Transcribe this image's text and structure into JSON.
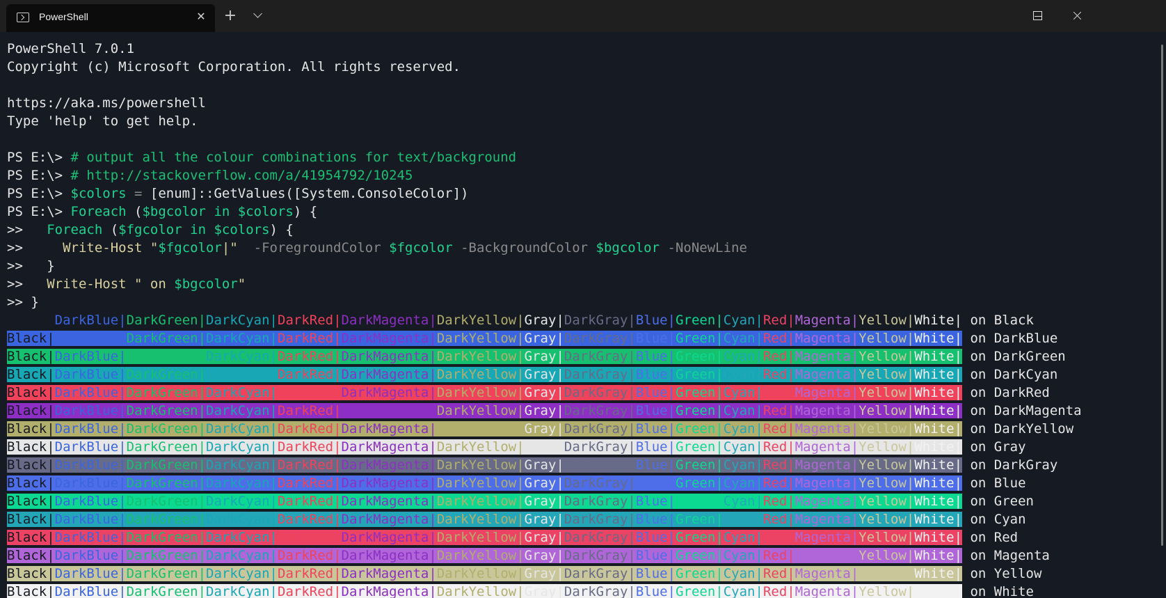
{
  "window": {
    "tab_title": "PowerShell",
    "tab_icon": "powershell-icon",
    "new_tab_icon": "plus-icon",
    "dropdown_icon": "chevron-down-icon",
    "min_icon": "minimize-icon",
    "max_icon": "maximize-icon",
    "close_icon": "close-icon"
  },
  "header_lines": [
    "PowerShell 7.0.1",
    "Copyright (c) Microsoft Corporation. All rights reserved.",
    "",
    "https://aka.ms/powershell",
    "Type 'help' to get help.",
    ""
  ],
  "script_lines": [
    [
      {
        "c": "t-plain",
        "t": "PS E:\\> "
      },
      {
        "c": "t-comment",
        "t": "# output all the colour combinations for text/background"
      }
    ],
    [
      {
        "c": "t-plain",
        "t": "PS E:\\> "
      },
      {
        "c": "t-comment",
        "t": "# http://stackoverflow.com/a/41954792/10245"
      }
    ],
    [
      {
        "c": "t-plain",
        "t": "PS E:\\> "
      },
      {
        "c": "t-var",
        "t": "$colors"
      },
      {
        "c": "t-param",
        "t": " = "
      },
      {
        "c": "t-plain",
        "t": "[enum]::"
      },
      {
        "c": "t-plain",
        "t": "GetValues"
      },
      {
        "c": "t-plain",
        "t": "([System.ConsoleColor])"
      }
    ],
    [
      {
        "c": "t-plain",
        "t": "PS E:\\> "
      },
      {
        "c": "t-kw",
        "t": "Foreach"
      },
      {
        "c": "t-plain",
        "t": " ("
      },
      {
        "c": "t-var",
        "t": "$bgcolor"
      },
      {
        "c": "t-kw",
        "t": " in "
      },
      {
        "c": "t-var",
        "t": "$colors"
      },
      {
        "c": "t-plain",
        "t": ") {"
      }
    ],
    [
      {
        "c": "t-plain",
        "t": ">>   "
      },
      {
        "c": "t-kw",
        "t": "Foreach"
      },
      {
        "c": "t-plain",
        "t": " ("
      },
      {
        "c": "t-var",
        "t": "$fgcolor"
      },
      {
        "c": "t-kw",
        "t": " in "
      },
      {
        "c": "t-var",
        "t": "$colors"
      },
      {
        "c": "t-plain",
        "t": ") {"
      }
    ],
    [
      {
        "c": "t-plain",
        "t": ">>     "
      },
      {
        "c": "t-str",
        "t": "Write-Host "
      },
      {
        "c": "t-str",
        "t": "\""
      },
      {
        "c": "t-var",
        "t": "$fgcolor"
      },
      {
        "c": "t-str",
        "t": "|\""
      },
      {
        "c": "t-param",
        "t": "  -ForegroundColor "
      },
      {
        "c": "t-var",
        "t": "$fgcolor"
      },
      {
        "c": "t-param",
        "t": " -BackgroundColor "
      },
      {
        "c": "t-var",
        "t": "$bgcolor"
      },
      {
        "c": "t-param",
        "t": " -NoNewLine"
      }
    ],
    [
      {
        "c": "t-plain",
        "t": ">>   }"
      }
    ],
    [
      {
        "c": "t-plain",
        "t": ">>   "
      },
      {
        "c": "t-str",
        "t": "Write-Host "
      },
      {
        "c": "t-str",
        "t": "\" on "
      },
      {
        "c": "t-var",
        "t": "$bgcolor"
      },
      {
        "c": "t-str",
        "t": "\""
      }
    ],
    [
      {
        "c": "t-plain",
        "t": ">> }"
      }
    ]
  ],
  "color_names": [
    "Black",
    "DarkBlue",
    "DarkGreen",
    "DarkCyan",
    "DarkRed",
    "DarkMagenta",
    "DarkYellow",
    "Gray",
    "DarkGray",
    "Blue",
    "Green",
    "Cyan",
    "Red",
    "Magenta",
    "Yellow",
    "White"
  ],
  "palette": {
    "Black": "#161a22",
    "DarkBlue": "#3b65e0",
    "DarkGreen": "#16c06f",
    "DarkCyan": "#18a7b5",
    "DarkRed": "#f0435b",
    "DarkMagenta": "#8d2fc4",
    "DarkYellow": "#b2ae6c",
    "Gray": "#e6e6e6",
    "DarkGray": "#676b87",
    "Blue": "#4e6ee9",
    "Green": "#0bd991",
    "Cyan": "#23a7b8",
    "Red": "#ec4263",
    "Magenta": "#b066d8",
    "Yellow": "#c9c699",
    "White": "#f2f2f2"
  },
  "on_label": " on "
}
